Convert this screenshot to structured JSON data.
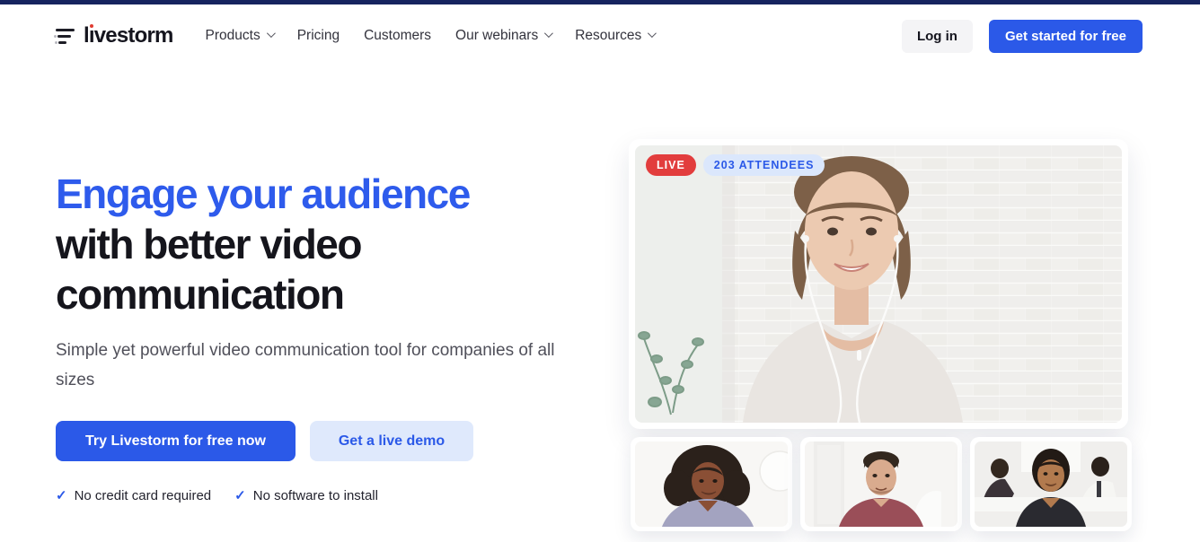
{
  "header": {
    "brand": {
      "icon": "livestorm-funnel-icon",
      "wordmark_before_i": "l",
      "wordmark_i": "ı",
      "wordmark_after_i": "vestorm"
    },
    "nav": [
      {
        "label": "Products",
        "has_dropdown": true
      },
      {
        "label": "Pricing",
        "has_dropdown": false
      },
      {
        "label": "Customers",
        "has_dropdown": false
      },
      {
        "label": "Our webinars",
        "has_dropdown": true
      },
      {
        "label": "Resources",
        "has_dropdown": true
      }
    ],
    "login_label": "Log in",
    "cta_label": "Get started for free"
  },
  "hero": {
    "title_line1": "Engage your audience",
    "title_line2": "with better video",
    "title_line3": "communication",
    "subtitle": "Simple yet powerful video communication tool for companies of all sizes",
    "primary_cta": "Try Livestorm for free now",
    "secondary_cta": "Get a live demo",
    "check_glyph": "✓",
    "bullets": [
      {
        "icon": "check-icon",
        "label": "No credit card required"
      },
      {
        "icon": "check-icon",
        "label": "No software to install"
      }
    ]
  },
  "video_panel": {
    "live_badge": "LIVE",
    "attendees_badge": "203 ATTENDEES",
    "main_video": "woman-speaker-on-white-brick-wall",
    "thumbnails": [
      "woman-curly-hair-lavender-top",
      "man-beard-maroon-shirt",
      "woman-black-top-office-with-coworkers"
    ]
  },
  "colors": {
    "top_bar_navy": "#16245f",
    "accent_blue": "#2b59e8",
    "heading_blue": "#2e5bec",
    "heading_dark": "#15151c",
    "body_gray": "#50505a",
    "live_red": "#e23d3d",
    "badge_light_blue": "#dbe7fc",
    "secondary_btn_bg": "#dfe9fc",
    "login_btn_bg": "#f4f4f6"
  }
}
